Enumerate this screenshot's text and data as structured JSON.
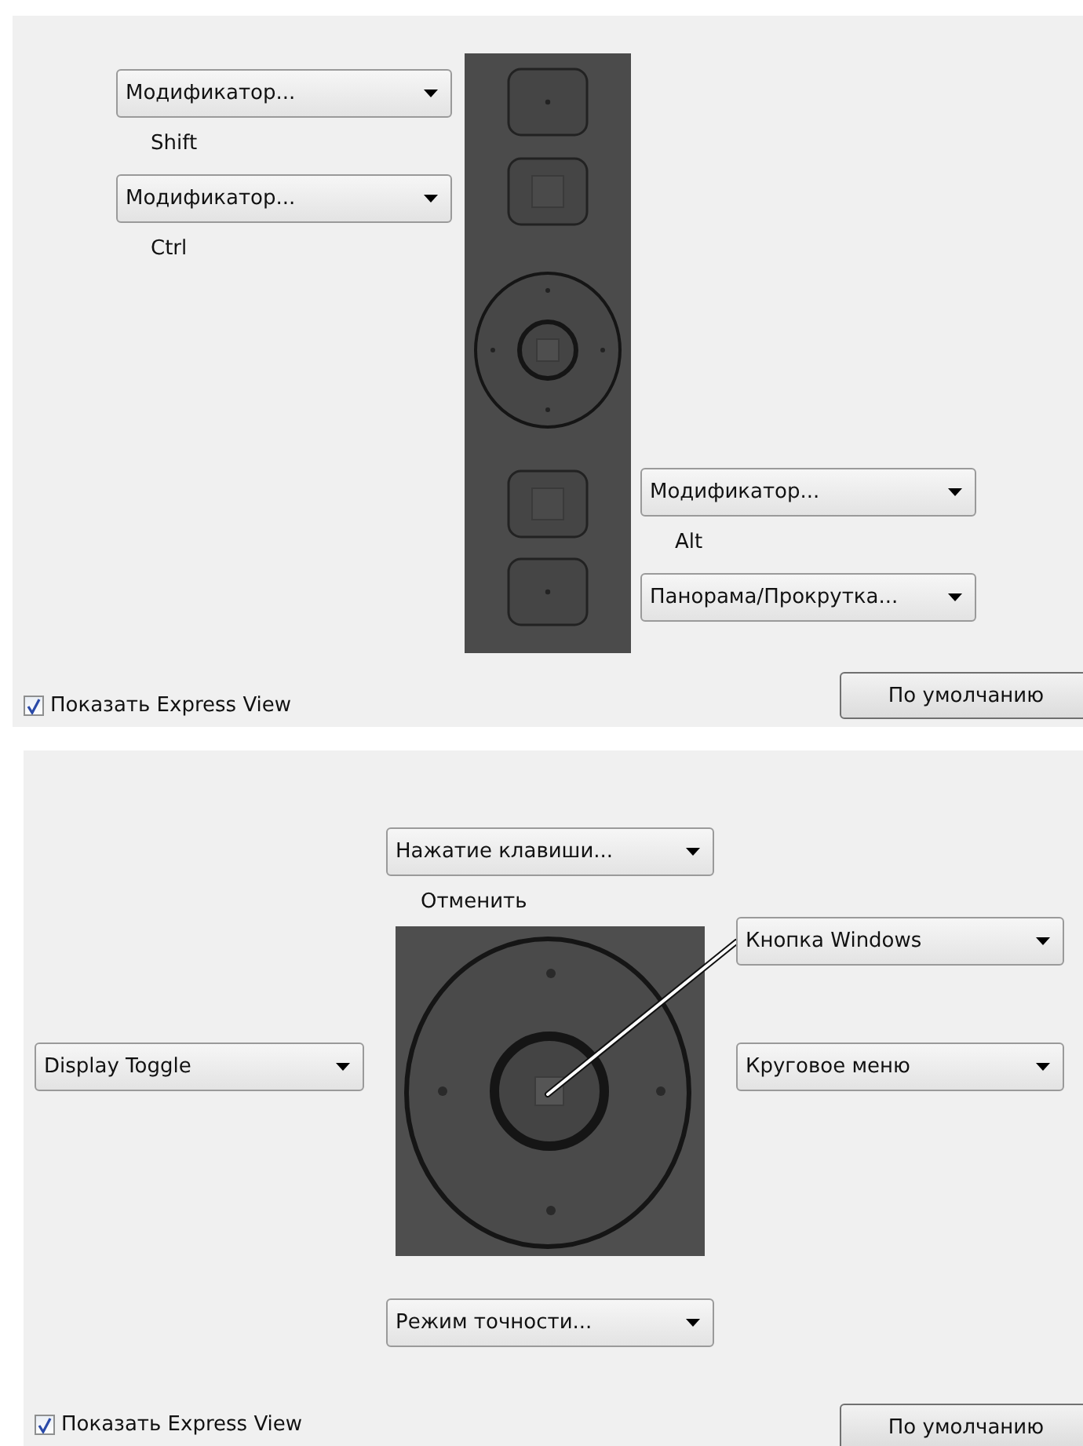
{
  "panels": [
    {
      "kind": "strip",
      "dropdowns": [
        {
          "value": "Модификатор...",
          "caption": "Shift"
        },
        {
          "value": "Модификатор...",
          "caption": "Ctrl"
        },
        {
          "value": "Модификатор...",
          "caption": "Alt"
        },
        {
          "value": "Панорама/Прокрутка..."
        }
      ],
      "checkbox": {
        "label": "Показать Express View",
        "checked": true
      },
      "button": "По умолчанию"
    },
    {
      "kind": "ring",
      "dropdowns": [
        {
          "value": "Нажатие клавиши...",
          "caption": "Отменить"
        },
        {
          "value": "Кнопка Windows"
        },
        {
          "value": "Display Toggle"
        },
        {
          "value": "Круговое меню"
        },
        {
          "value": "Режим точности..."
        }
      ],
      "checkbox": {
        "label": "Показать Express View",
        "checked": true
      },
      "button": "По умолчанию"
    }
  ]
}
